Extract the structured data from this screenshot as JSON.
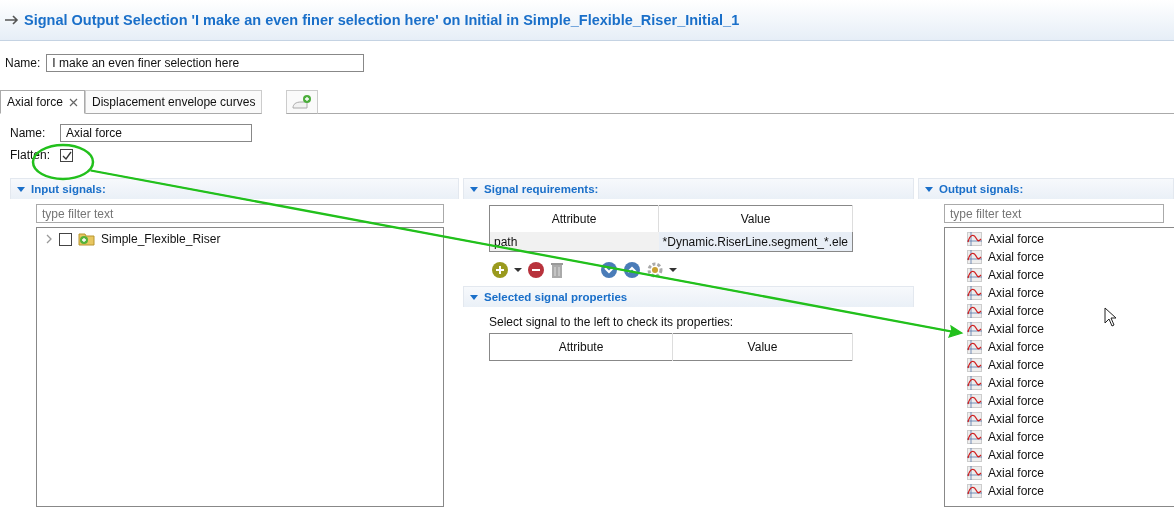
{
  "window": {
    "title": "Signal Output Selection 'I make an even finer selection here' on Initial in Simple_Flexible_Riser_Initial_1"
  },
  "name_field": {
    "label": "Name:",
    "value": "I make an even finer selection here"
  },
  "tabs": [
    {
      "label": "Axial force",
      "selected": true,
      "closable": true
    },
    {
      "label": "Displacement envelope curves",
      "selected": false,
      "closable": false
    }
  ],
  "detail": {
    "name_label": "Name:",
    "name_value": "Axial force",
    "flatten_label": "Flatten:",
    "flatten_checked": true
  },
  "input_signals": {
    "title": "Input signals:",
    "filter": {
      "placeholder": "type filter text"
    },
    "tree": [
      {
        "label": "Simple_Flexible_Riser",
        "checked": false,
        "expanded": false
      }
    ]
  },
  "signal_requirements": {
    "title": "Signal requirements:",
    "columns": [
      "Attribute",
      "Value"
    ],
    "rows": [
      [
        "path",
        "*Dynamic.RiserLine.segment_*.ele"
      ]
    ]
  },
  "selected_signal_properties": {
    "title": "Selected signal properties",
    "hint": "Select signal to the left to check its properties:",
    "columns": [
      "Attribute",
      "Value"
    ]
  },
  "output_signals": {
    "title": "Output signals:",
    "filter": {
      "placeholder": "type filter text"
    },
    "items": [
      "Axial force",
      "Axial force",
      "Axial force",
      "Axial force",
      "Axial force",
      "Axial force",
      "Axial force",
      "Axial force",
      "Axial force",
      "Axial force",
      "Axial force",
      "Axial force",
      "Axial force",
      "Axial force",
      "Axial force"
    ]
  }
}
